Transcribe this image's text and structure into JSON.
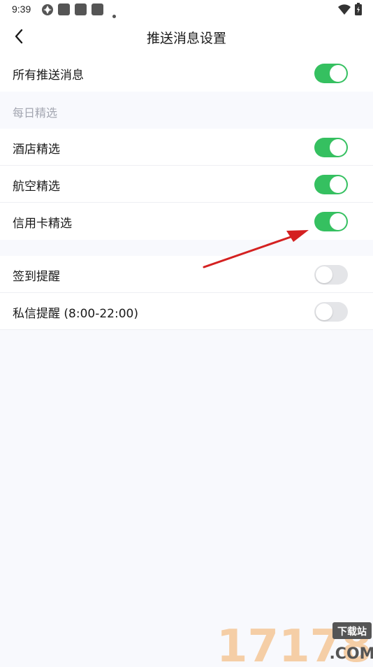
{
  "status_bar": {
    "time": "9:39"
  },
  "header": {
    "title": "推送消息设置"
  },
  "settings": {
    "all_push": {
      "label": "所有推送消息",
      "enabled": true
    },
    "daily_section": {
      "label": "每日精选"
    },
    "daily_items": [
      {
        "label": "酒店精选",
        "enabled": true
      },
      {
        "label": "航空精选",
        "enabled": true
      },
      {
        "label": "信用卡精选",
        "enabled": true
      }
    ],
    "reminder_items": [
      {
        "label": "签到提醒",
        "enabled": false
      },
      {
        "label": "私信提醒 (8:00-22:00)",
        "enabled": false
      }
    ]
  },
  "watermark": {
    "number": "17178",
    "tag": "下载站",
    "domain": ".COM"
  },
  "colors": {
    "toggle_on": "#35c060",
    "toggle_off": "#e4e5e8",
    "annotation_arrow": "#d42121"
  }
}
